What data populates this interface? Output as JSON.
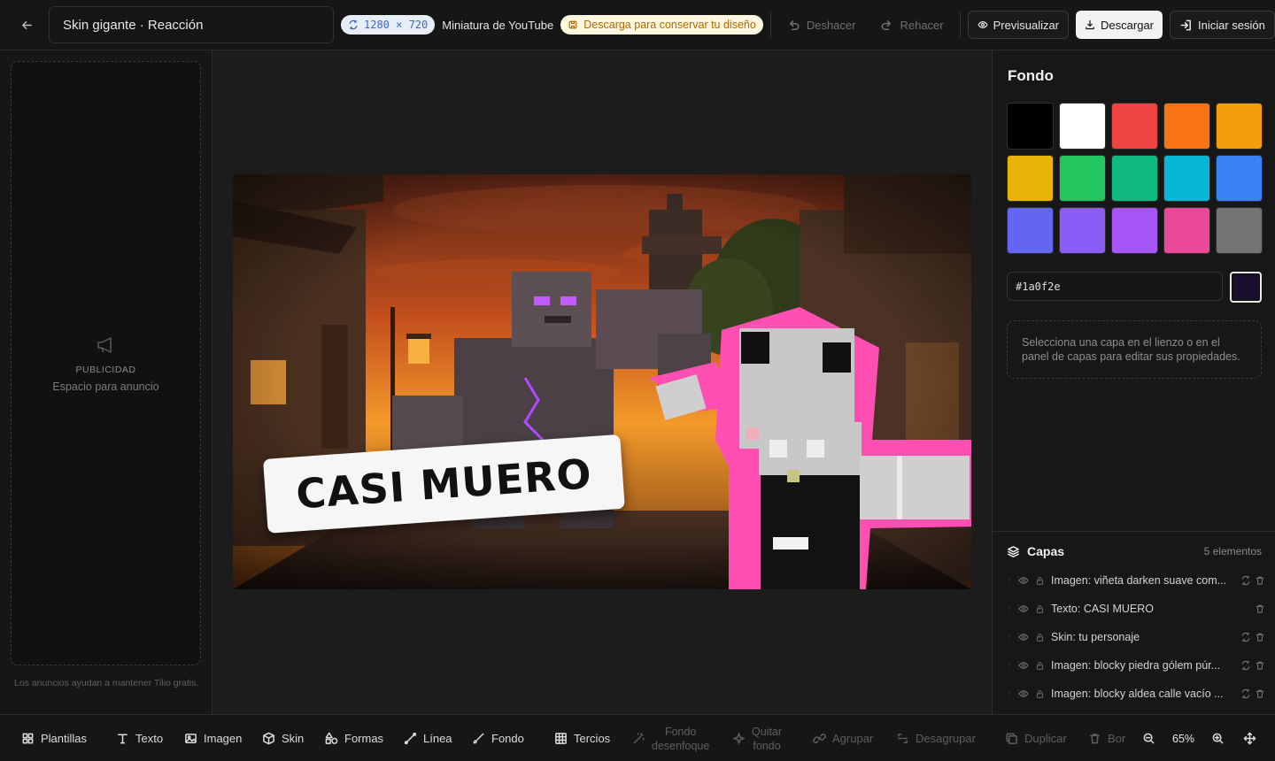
{
  "header": {
    "project_title": "Skin gigante · Reacción",
    "dimensions": "1280 × 720",
    "format": "Miniatura de YouTube",
    "download_warning": "Descarga para conservar tu diseño",
    "undo": "Deshacer",
    "redo": "Rehacer",
    "preview": "Previsualizar",
    "download": "Descargar",
    "login": "Iniciar sesión"
  },
  "ad": {
    "title": "PUBLICIDAD",
    "subtitle": "Espacio para anuncio",
    "note": "Los anuncios ayudan a mantener Tilio gratis."
  },
  "canvas": {
    "title_text": "CASI MUERO"
  },
  "right_panel": {
    "title": "Fondo",
    "swatches": [
      "#000000",
      "#ffffff",
      "#ef4444",
      "#f97316",
      "#f59e0b",
      "#eab308",
      "#22c55e",
      "#10b981",
      "#06b6d4",
      "#3b82f6",
      "#6366f1",
      "#8b5cf6",
      "#a855f7",
      "#ec4899",
      "#737373"
    ],
    "hex_value": "#1a0f2e",
    "hint": "Selecciona una capa en el lienzo o en el panel de capas para editar sus propiedades."
  },
  "layers": {
    "title": "Capas",
    "count": "5 elementos",
    "items": [
      {
        "name": "Imagen: viñeta darken suave com...",
        "has_replace": true
      },
      {
        "name": "Texto: CASI MUERO",
        "has_replace": false
      },
      {
        "name": "Skin: tu personaje",
        "has_replace": true
      },
      {
        "name": "Imagen: blocky piedra gólem púr...",
        "has_replace": true
      },
      {
        "name": "Imagen: blocky aldea calle vacío ...",
        "has_replace": true
      }
    ]
  },
  "toolbar": {
    "templates": "Plantillas",
    "text": "Texto",
    "image": "Imagen",
    "skin": "Skin",
    "shapes": "Formas",
    "line": "Línea",
    "background": "Fondo",
    "thirds": "Tercios",
    "blur_bg_1": "Fondo",
    "blur_bg_2": "desenfoque",
    "remove_bg_1": "Quitar",
    "remove_bg_2": "fondo",
    "group": "Agrupar",
    "ungroup": "Desagrupar",
    "duplicate": "Duplicar",
    "delete": "Bor",
    "zoom": "65%"
  }
}
